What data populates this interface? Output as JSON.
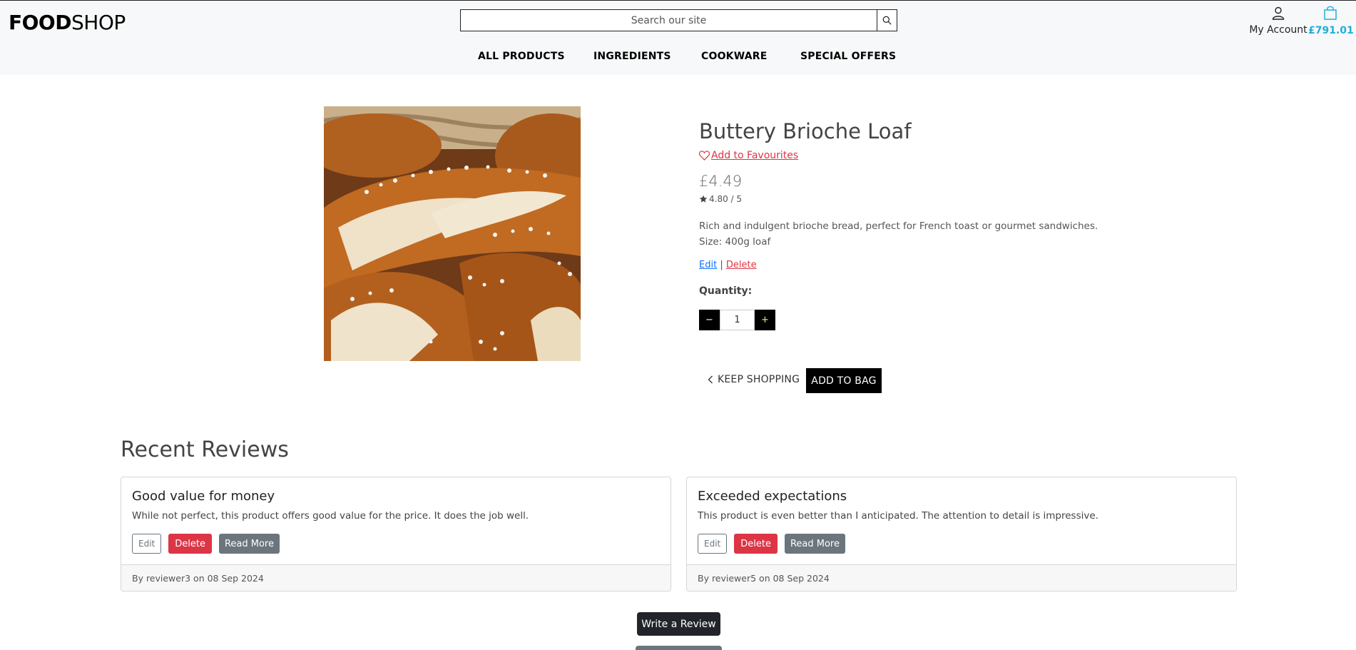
{
  "header": {
    "logo_bold": "FOOD",
    "logo_regular": "SHOP",
    "search_placeholder": "Search our site",
    "account_label": "My Account",
    "bag_total": "£791.01"
  },
  "nav": {
    "items": [
      "ALL PRODUCTS",
      "INGREDIENTS",
      "COOKWARE",
      "SPECIAL OFFERS"
    ]
  },
  "product": {
    "title": "Buttery Brioche Loaf",
    "favourite_label": "Add to Favourites",
    "price": "£4.49",
    "rating": "4.80 / 5",
    "description": "Rich and indulgent brioche bread, perfect for French toast or gourmet sandwiches.",
    "size": "Size: 400g loaf",
    "edit_label": "Edit",
    "separator": "|",
    "delete_label": "Delete",
    "quantity_label": "Quantity:",
    "quantity_value": "1",
    "minus": "−",
    "plus": "+",
    "keep_shopping": "KEEP SHOPPING",
    "add_to_bag": "ADD TO BAG"
  },
  "reviews": {
    "heading": "Recent Reviews",
    "items": [
      {
        "title": "Good value for money",
        "text": "While not perfect, this product offers good value for the price. It does the job well.",
        "edit": "Edit",
        "delete": "Delete",
        "read_more": "Read More",
        "footer": "By reviewer3 on 08 Sep 2024"
      },
      {
        "title": "Exceeded expectations",
        "text": "This product is even better than I anticipated. The attention to detail is impressive.",
        "edit": "Edit",
        "delete": "Delete",
        "read_more": "Read More",
        "footer": "By reviewer5 on 08 Sep 2024"
      }
    ],
    "write_review": "Write a Review"
  },
  "colors": {
    "accent_bag": "#1fb0d8",
    "danger": "#dc3545",
    "link": "#0d6efd",
    "secondary": "#6c757d"
  },
  "icons": [
    "search-icon",
    "user-icon",
    "shopping-bag-icon",
    "heart-icon",
    "star-icon",
    "chevron-left-icon"
  ]
}
